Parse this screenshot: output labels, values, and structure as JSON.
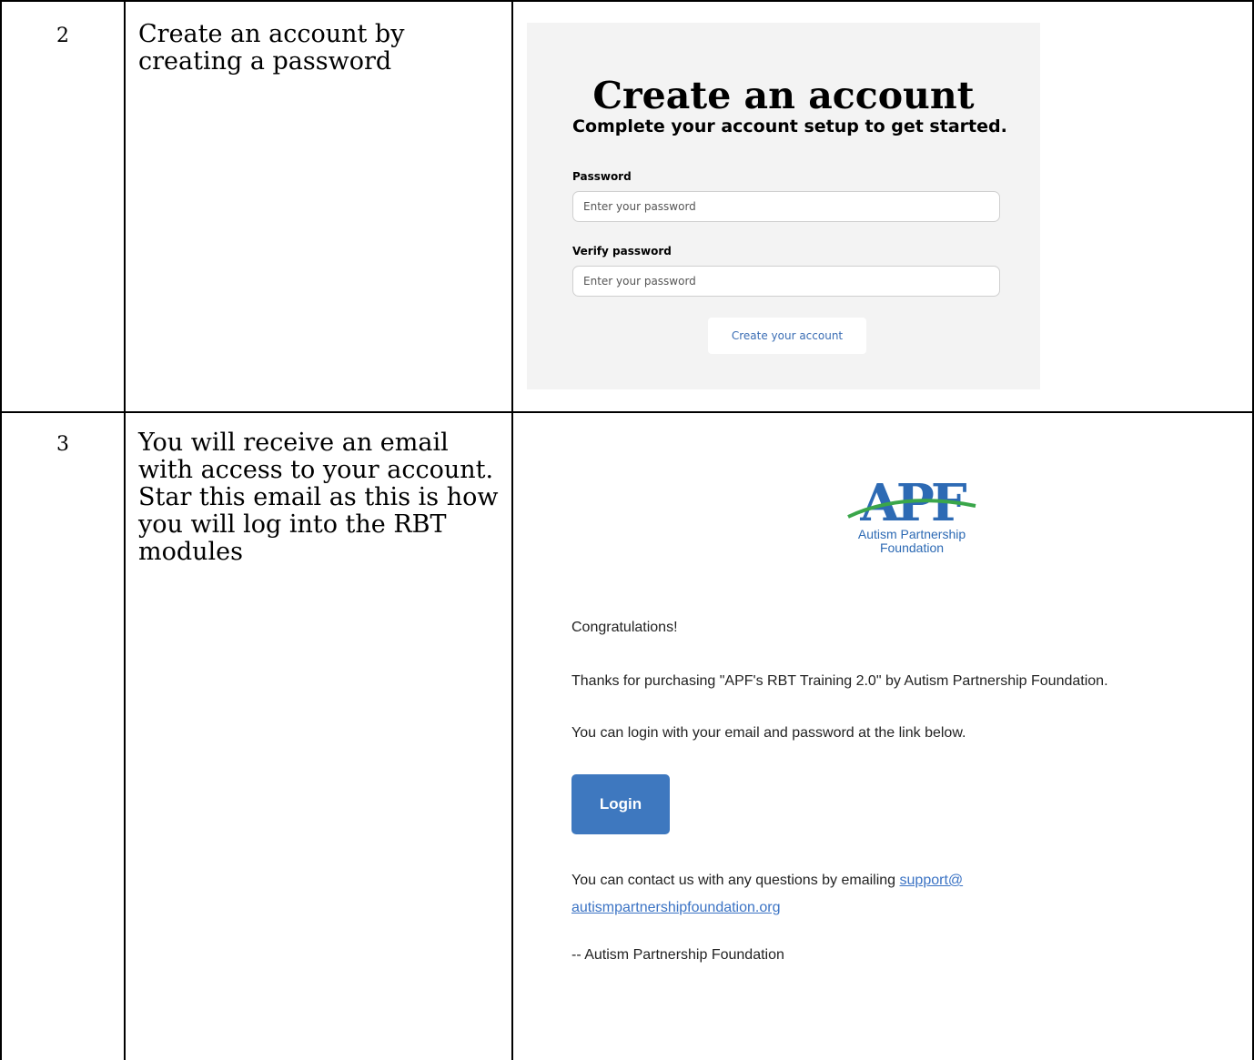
{
  "rows": [
    {
      "number": "2",
      "instruction": "Create an account by creating a password"
    },
    {
      "number": "3",
      "instruction": "You will receive an email with access to your account. Star this email as this is how you will log into the RBT modules"
    }
  ],
  "signup": {
    "title": "Create an account",
    "subtitle": "Complete your account setup to get started.",
    "password_label": "Password",
    "password_placeholder": "Enter your password",
    "verify_label": "Verify password",
    "verify_placeholder": "Enter your password",
    "submit_label": "Create your account"
  },
  "email": {
    "logo_letters": "APF",
    "logo_line1": "Autism Partnership",
    "logo_line2": "Foundation",
    "greeting": "Congratulations!",
    "thanks": "Thanks for purchasing \"APF's RBT Training 2.0\" by Autism Partnership Foundation.",
    "login_info": "You can login with your email and password at the link below.",
    "login_button": "Login",
    "contact_prefix": "You can contact us with any questions by emailing ",
    "contact_link_part1": "support@",
    "contact_link_part2": "autismpartnershipfoundation.org",
    "signature": "-- Autism Partnership Foundation"
  },
  "colors": {
    "login_button": "#3e78bf",
    "link": "#3b73c4",
    "card_background": "#f3f3f3",
    "logo_blue": "#2d6ab4",
    "logo_green": "#3aa64a"
  }
}
